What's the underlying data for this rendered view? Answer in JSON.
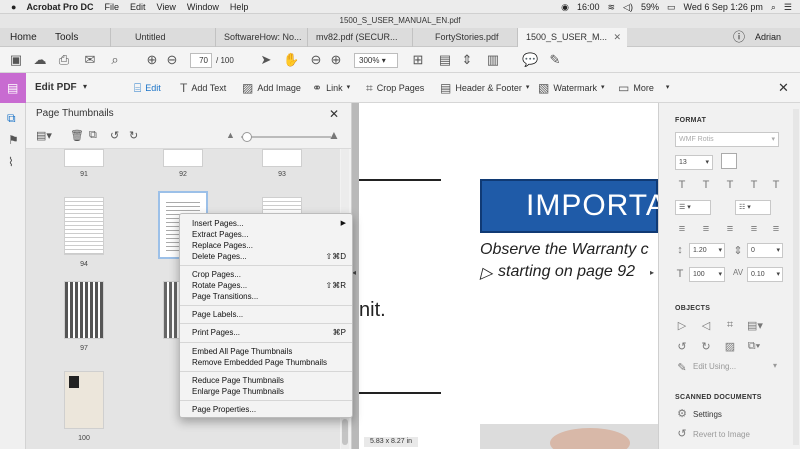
{
  "menubar": {
    "app": "Acrobat Pro DC",
    "items": [
      "File",
      "Edit",
      "View",
      "Window",
      "Help"
    ],
    "time": "16:00",
    "battery": "59%",
    "datetime": "Wed 6 Sep  1:26 pm"
  },
  "window_title": "1500_S_USER_MANUAL_EN.pdf",
  "tabs": {
    "home": "Home",
    "tools": "Tools",
    "docs": [
      "Untitled",
      "SoftwareHow: No...",
      "mv82.pdf (SECUR...",
      "FortyStories.pdf",
      "1500_S_USER_M..."
    ],
    "user": "Adrian"
  },
  "toolbar": {
    "page_current": "70",
    "page_total": "/ 100",
    "zoom": "300%"
  },
  "edit_toolbar": {
    "title": "Edit PDF",
    "tools": [
      "Edit",
      "Add Text",
      "Add Image",
      "Link",
      "Crop Pages",
      "Header & Footer",
      "Watermark",
      "More"
    ]
  },
  "panel": {
    "title": "Page Thumbnails",
    "labels": [
      "91",
      "92",
      "93",
      "94",
      "97",
      "100"
    ]
  },
  "context_menu": {
    "insert": "Insert Pages...",
    "extract": "Extract Pages...",
    "replace": "Replace Pages...",
    "delete": "Delete Pages...",
    "delete_sc": "⇧⌘D",
    "crop": "Crop Pages...",
    "rotate": "Rotate Pages...",
    "rotate_sc": "⇧⌘R",
    "transitions": "Page Transitions...",
    "labels": "Page Labels...",
    "print": "Print Pages...",
    "print_sc": "⌘P",
    "embed": "Embed All Page Thumbnails",
    "remove": "Remove Embedded Page Thumbnails",
    "reduce": "Reduce Page Thumbnails",
    "enlarge": "Enlarge Page Thumbnails",
    "properties": "Page Properties..."
  },
  "document": {
    "banner": "IMPORTA",
    "line1": "Observe the Warranty c",
    "line2": "starting on page 92",
    "fragment": "nit.",
    "page_size": "5.83 x 8.27 in"
  },
  "format_panel": {
    "format_title": "FORMAT",
    "font": "WMF Rotis",
    "font_size": "13",
    "line_spacing": "1.20",
    "para_spacing": "0",
    "scale": "100",
    "char_spacing": "0.10",
    "objects_title": "OBJECTS",
    "edit_using": "Edit Using...",
    "scanned_title": "SCANNED DOCUMENTS",
    "settings": "Settings",
    "revert": "Revert to Image"
  },
  "colors": {
    "banner": "#1f5ba8",
    "accent": "#1a73c7",
    "tool_purple": "#c86bd1"
  }
}
